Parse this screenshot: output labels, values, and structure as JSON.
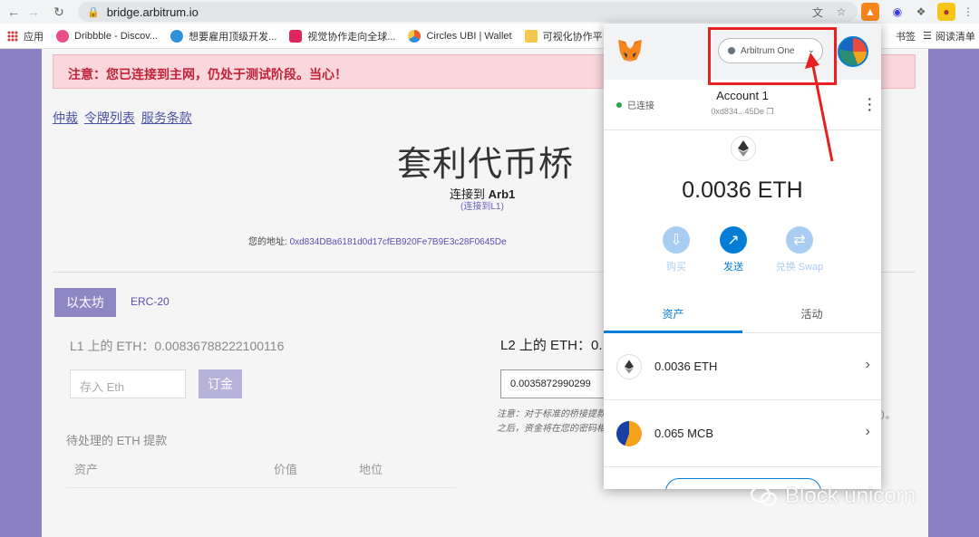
{
  "browser": {
    "url": "bridge.arbitrum.io",
    "bookmarks": [
      {
        "label": "应用",
        "color": "#d33"
      },
      {
        "label": "Dribbble - Discov...",
        "color": "#ea4c89"
      },
      {
        "label": "想要雇用顶级开发...",
        "color": "#2f8fd8"
      },
      {
        "label": "视觉协作走向全球...",
        "color": "#e0245e"
      },
      {
        "label": "Circles UBI | Wallet",
        "color": "#f05a28"
      },
      {
        "label": "可视化协作平台",
        "color": "#f2c94c"
      }
    ],
    "bookmarks_right": [
      {
        "label": "书签"
      },
      {
        "label": "阅读清单"
      }
    ]
  },
  "page": {
    "warning": "注意：您已连接到主网，仍处于测试阶段。当心！",
    "links": [
      "仲裁",
      "令牌列表",
      "服务条款"
    ],
    "title": "套利代币桥",
    "connected_to_label": "连接到",
    "connected_to_value": "Arb1",
    "connected_sub": "(连接到L1)",
    "address_label": "您的地址:",
    "address_value": "0xd834DBa6181d0d17cfEB920Fe7B9E3c28F0645De",
    "tabs": [
      "以太坊",
      "ERC-20"
    ],
    "l1_label": "L1 上的 ETH：",
    "l1_value": "0.00836788222100116",
    "deposit_placeholder": "存入 Eth",
    "deposit_button": "订金",
    "l2_label": "L2 上的 ETH：",
    "l2_value_partial": "0.",
    "l2_input_value": "0.0035872990299",
    "note_line1": "注意：对于标准的桥接提款",
    "note_line2": "之后，资金将在您的密码相",
    "note_tail": "）。",
    "pending_title": "待处理的 ETH 提款",
    "table_headers": [
      "资产",
      "价值",
      "地位"
    ]
  },
  "metamask": {
    "network": "Arbitrum One",
    "connected": "已连接",
    "account_name": "Account 1",
    "account_address": "0xd834...45De",
    "balance": "0.0036 ETH",
    "actions": [
      {
        "label": "购买",
        "color": "#a9cdf0"
      },
      {
        "label": "发送",
        "color": "#037dd6"
      },
      {
        "label": "兑换 Swap",
        "color": "#a9cdf0"
      }
    ],
    "tabs": [
      "资产",
      "活动"
    ],
    "assets": [
      {
        "value": "0.0036 ETH"
      },
      {
        "value": "0.065 MCB"
      }
    ]
  },
  "watermark": "Block unicorn"
}
